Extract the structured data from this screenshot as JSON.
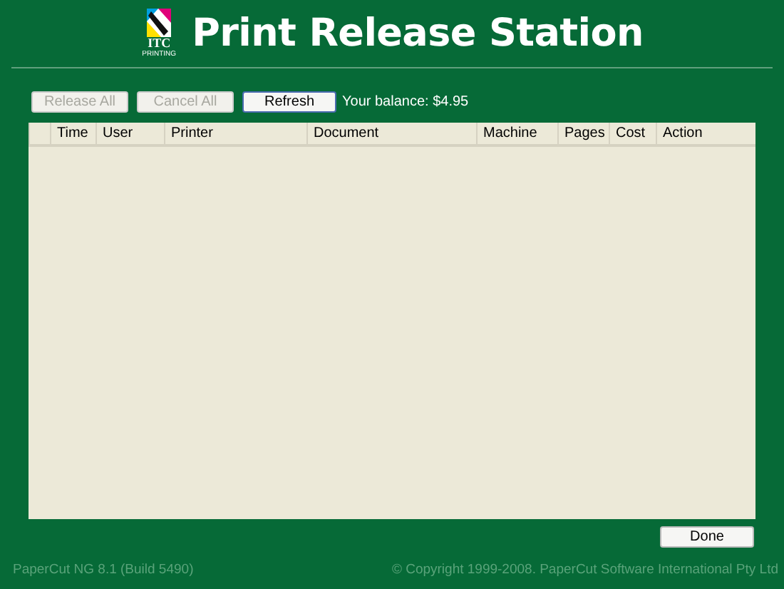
{
  "header": {
    "logo": {
      "name": "ITC",
      "tagline": "PRINTING"
    },
    "title": "Print Release Station"
  },
  "toolbar": {
    "buttons": [
      {
        "label": "Release All",
        "disabled": true
      },
      {
        "label": "Cancel All",
        "disabled": true
      },
      {
        "label": "Refresh",
        "disabled": false
      }
    ],
    "balance": "Your balance: $4.95"
  },
  "table": {
    "columns": [
      "",
      "Time",
      "User",
      "Printer",
      "Document",
      "Machine",
      "Pages",
      "Cost",
      "Action"
    ]
  },
  "done_button": "Done",
  "status_bar": {
    "version": "PaperCut NG 8.1 (Build 5490)",
    "copyright": "© Copyright 1999-2008. PaperCut Software International Pty Ltd"
  }
}
